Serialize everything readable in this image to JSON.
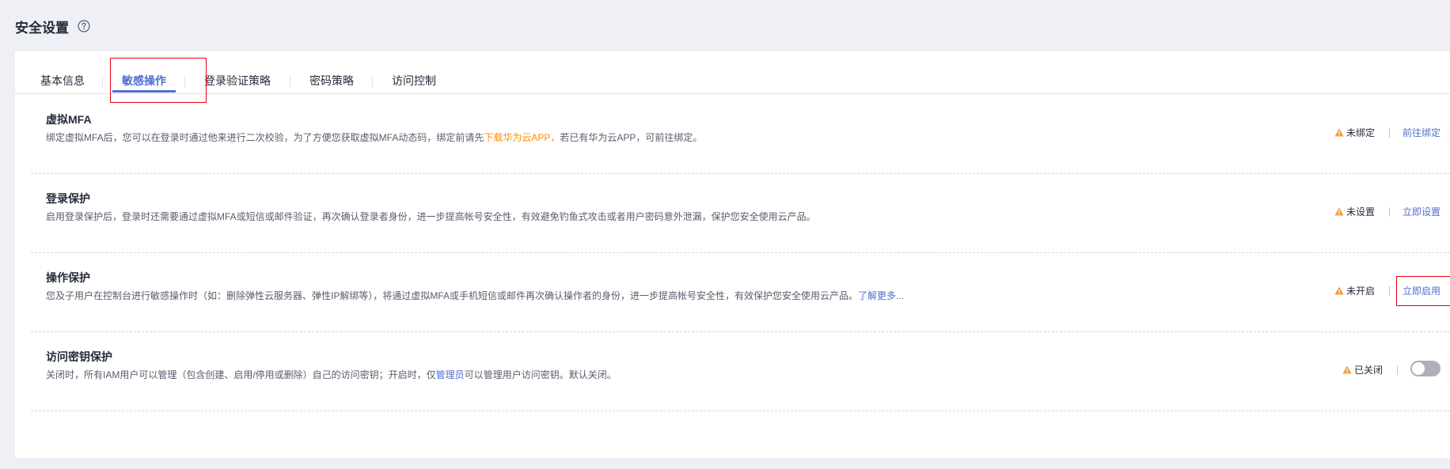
{
  "header": {
    "title": "安全设置"
  },
  "tabs": [
    {
      "label": "基本信息"
    },
    {
      "label": "敏感操作"
    },
    {
      "label": "登录验证策略"
    },
    {
      "label": "密码策略"
    },
    {
      "label": "访问控制"
    }
  ],
  "active_tab": "敏感操作",
  "rows": [
    {
      "title": "虚拟MFA",
      "desc_prefix": "绑定虚拟MFA后，您可以在登录时通过他来进行二次校验，为了方便您获取虚拟MFA动态码，绑定前请先",
      "desc_link": "下载华为云APP，",
      "desc_suffix": "若已有华为云APP，可前往绑定。",
      "status": "未绑定",
      "action": "前往绑定"
    },
    {
      "title": "登录保护",
      "desc": "启用登录保护后，登录时还需要通过虚拟MFA或短信或邮件验证，再次确认登录者身份，进一步提高帐号安全性，有效避免钓鱼式攻击或者用户密码意外泄漏，保护您安全使用云产品。",
      "status": "未设置",
      "action": "立即设置"
    },
    {
      "title": "操作保护",
      "desc_prefix": "您及子用户在控制台进行敏感操作时（如：删除弹性云服务器、弹性IP解绑等），将通过虚拟MFA或手机短信或邮件再次确认操作者的身份，进一步提高帐号安全性，有效保护您安全使用云产品。",
      "desc_link": "了解更多...",
      "status": "未开启",
      "action": "立即启用"
    },
    {
      "title": "访问密钥保护",
      "desc_prefix": "关闭时，所有IAM用户可以管理（包含创建、启用/停用或删除）自己的访问密钥；开启时，仅",
      "desc_link": "管理员",
      "desc_suffix": "可以管理用户访问密钥。默认关闭。",
      "status": "已关闭",
      "toggle_on": false
    }
  ],
  "colors": {
    "accent": "#526ecc",
    "warning": "#f39c3c",
    "highlight": "#e60012",
    "orange_link": "#ff8c00"
  }
}
